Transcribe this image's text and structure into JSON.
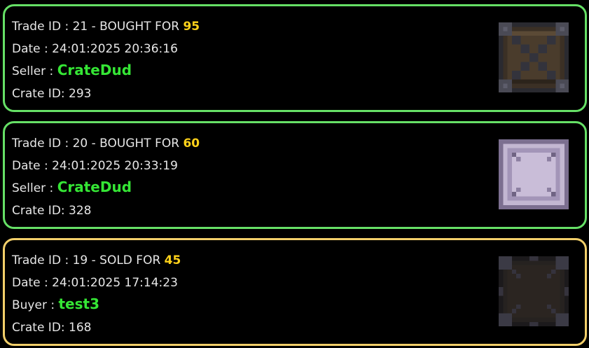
{
  "trades": [
    {
      "prefix": "Trade ID : 21 - BOUGHT FOR ",
      "price": "95",
      "date": "Date : 24:01:2025 20:36:16",
      "party_label": "Seller : ",
      "party_name": "CrateDud",
      "crate_id": "Crate ID: 293",
      "type": "bought",
      "icon": "wooden-crate-icon"
    },
    {
      "prefix": "Trade ID : 20 - BOUGHT FOR ",
      "price": "60",
      "date": "Date : 24:01:2025 20:33:19",
      "party_label": "Seller : ",
      "party_name": "CrateDud",
      "crate_id": "Crate ID: 328",
      "type": "bought",
      "icon": "lavender-crate-icon"
    },
    {
      "prefix": "Trade ID : 19 - SOLD FOR ",
      "price": "45",
      "date": "Date : 24:01:2025 17:14:23",
      "party_label": "Buyer : ",
      "party_name": "test3",
      "crate_id": "Crate ID: 168",
      "type": "sold",
      "icon": "dark-crate-icon"
    }
  ],
  "colors": {
    "bought_border": "#66e066",
    "sold_border": "#f2cf6a",
    "price": "#ffd21a",
    "party_name": "#35e635",
    "text": "#e6e6e6",
    "background": "#000000"
  }
}
